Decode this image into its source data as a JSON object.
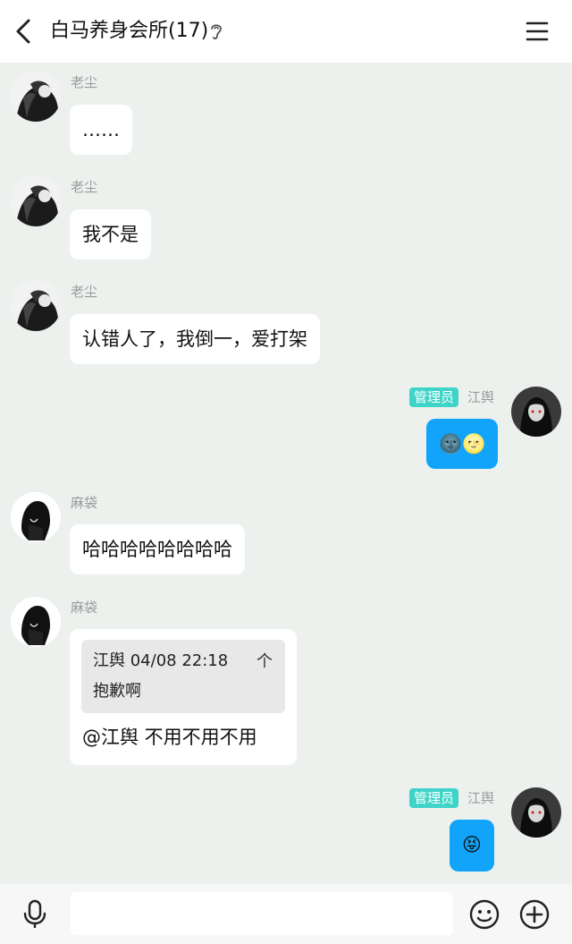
{
  "header": {
    "title": "白马养身会所(17)",
    "back_icon": "chevron-left-icon",
    "ear_icon": "ear-icon",
    "menu_icon": "hamburger-menu-icon"
  },
  "messages": [
    {
      "sender": "老尘",
      "text": "……",
      "side": "left"
    },
    {
      "sender": "老尘",
      "text": "我不是",
      "side": "left"
    },
    {
      "sender": "老尘",
      "text": "认错人了，我倒一，爱打架",
      "side": "left"
    },
    {
      "sender": "江舆",
      "badge": "管理员",
      "text": "🌚🌝",
      "side": "right"
    },
    {
      "sender": "麻袋",
      "text": "哈哈哈哈哈哈哈哈",
      "side": "left"
    },
    {
      "sender": "麻袋",
      "side": "left",
      "quote": {
        "meta": "江舆 04/08 22:18",
        "text": "抱歉啊",
        "jump": "个"
      },
      "text": "@江舆 不用不用不用"
    },
    {
      "sender": "江舆",
      "badge": "管理员",
      "text": "😝",
      "side": "right"
    }
  ],
  "input": {
    "value": "",
    "placeholder": ""
  },
  "colors": {
    "background": "#edf1ee",
    "self_bubble": "#12a4fa",
    "admin_badge": "#3fd4c8"
  }
}
